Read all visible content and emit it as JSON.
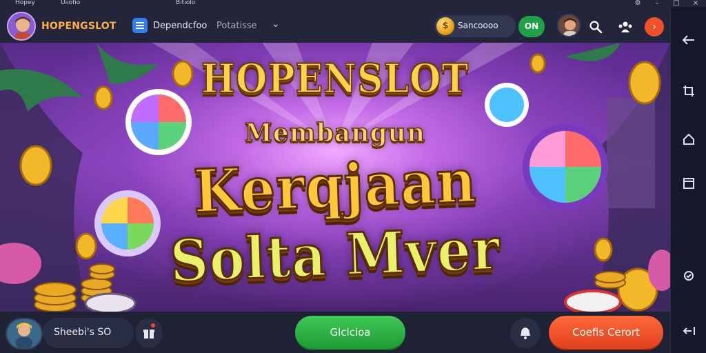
{
  "os_strip": {
    "app_label": "Hopey",
    "app_label2": "Uiiofio",
    "window_title": "Bitiolo"
  },
  "topbar": {
    "brand": "HOPENGSLOT",
    "tab_title": "Dependcfoo",
    "tab_subtitle": "Potatisse",
    "balance": "Sancoooo",
    "coin_glyph": "$",
    "on_label": "ON"
  },
  "banner": {
    "line1": "HOPENSLOT",
    "line2": "Membangun",
    "line3": "Kerqjaan",
    "line4": "Solta Mver"
  },
  "bottombar": {
    "username": "Sheebi's SO",
    "green_button": "Glclcioa",
    "orange_button": "Coefis Cerort"
  },
  "colors": {
    "brand": "#ffb043",
    "on_green": "#21a04a",
    "cta_green": "#2fb347",
    "cta_orange": "#f0502a",
    "bar_bg": "#23263a"
  },
  "icons": [
    "search-icon",
    "users-icon",
    "arrow-right-icon",
    "gift-icon",
    "bell-icon",
    "back-arrow-icon",
    "crop-icon",
    "home-icon",
    "square-icon",
    "settings-icon",
    "exit-icon"
  ]
}
